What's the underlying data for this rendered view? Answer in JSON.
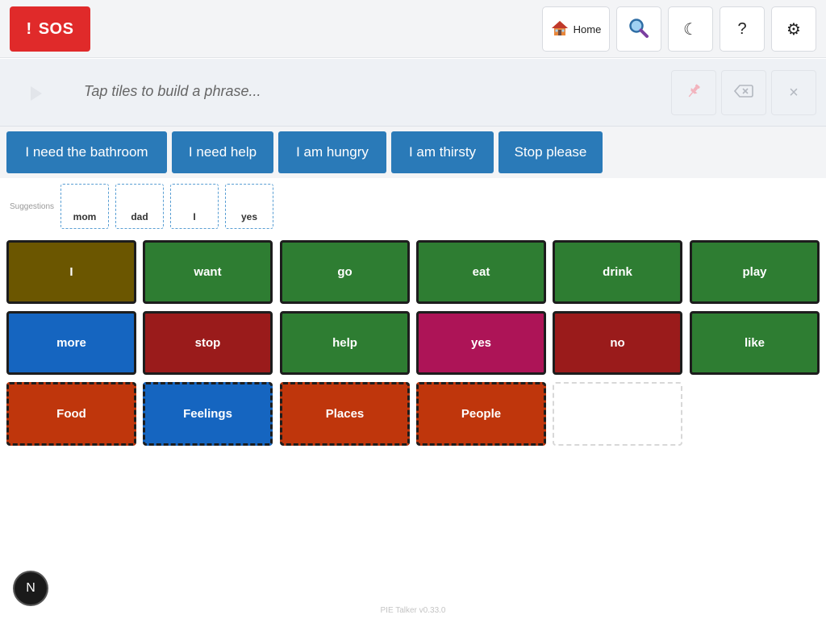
{
  "topbar": {
    "sos_icon": "!",
    "sos_label": "SOS",
    "home_label": "Home",
    "home_icon": "house-icon",
    "search_icon": "magnifier-icon",
    "dark_mode_glyph": "☾",
    "help_glyph": "?",
    "settings_glyph": "⚙"
  },
  "phrasebar": {
    "placeholder": "Tap tiles to build a phrase...",
    "clear_glyph": "×"
  },
  "quick_phrases": [
    "I need the bathroom",
    "I need help",
    "I am hungry",
    "I am thirsty",
    "Stop please"
  ],
  "suggestions": {
    "label": "Suggestions",
    "items": [
      "mom",
      "dad",
      "I",
      "yes"
    ]
  },
  "tiles": [
    {
      "label": "I",
      "color": "#6b5600",
      "folder": false
    },
    {
      "label": "want",
      "color": "#2e7d32",
      "folder": false
    },
    {
      "label": "go",
      "color": "#2e7d32",
      "folder": false
    },
    {
      "label": "eat",
      "color": "#2e7d32",
      "folder": false
    },
    {
      "label": "drink",
      "color": "#2e7d32",
      "folder": false
    },
    {
      "label": "play",
      "color": "#2e7d32",
      "folder": false
    },
    {
      "label": "more",
      "color": "#1565c0",
      "folder": false
    },
    {
      "label": "stop",
      "color": "#9a1b1b",
      "folder": false
    },
    {
      "label": "help",
      "color": "#2e7d32",
      "folder": false
    },
    {
      "label": "yes",
      "color": "#ad1457",
      "folder": false
    },
    {
      "label": "no",
      "color": "#9a1b1b",
      "folder": false
    },
    {
      "label": "like",
      "color": "#2e7d32",
      "folder": false
    },
    {
      "label": "Food",
      "color": "#bf360c",
      "folder": true
    },
    {
      "label": "Feelings",
      "color": "#1565c0",
      "folder": true
    },
    {
      "label": "Places",
      "color": "#bf360c",
      "folder": true
    },
    {
      "label": "People",
      "color": "#bf360c",
      "folder": true
    }
  ],
  "footer": {
    "version": "PIE Talker v0.33.0",
    "badge": "N"
  }
}
